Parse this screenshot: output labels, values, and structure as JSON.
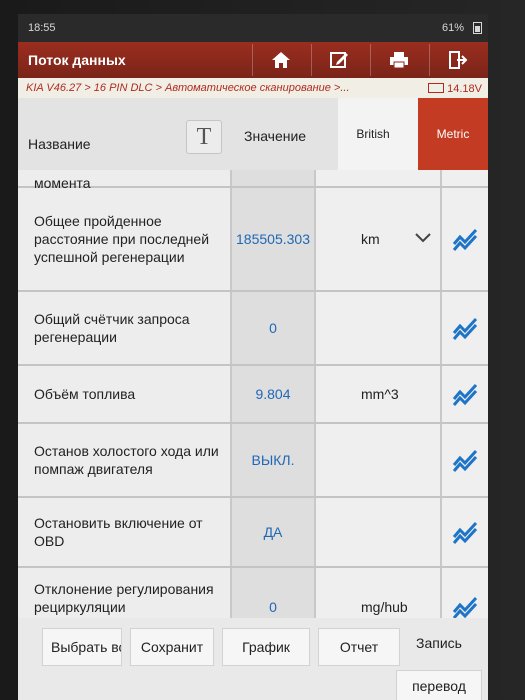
{
  "status": {
    "time": "18:55",
    "battery": "61%"
  },
  "appbar": {
    "title": "Поток данных"
  },
  "breadcrumb": {
    "path": "KIA V46.27 > 16 PIN DLC > Автоматическое сканирование >...",
    "voltage": "14.18V"
  },
  "header": {
    "name_label": "Название",
    "value_label": "Значение",
    "unit_british": "British",
    "unit_metric": "Metric",
    "t_icon": "T"
  },
  "rows": [
    {
      "name": "момента",
      "value": "",
      "unit": ""
    },
    {
      "name": "Общее пройденное расстояние при последней успешной регенерации",
      "value": "185505.303",
      "unit": "km"
    },
    {
      "name": "Общий счётчик запроса регенерации",
      "value": "0",
      "unit": ""
    },
    {
      "name": "Объём топлива",
      "value": "9.804",
      "unit": "mm^3"
    },
    {
      "name": "Останов холостого хода или помпаж двигателя",
      "value": "ВЫКЛ.",
      "unit": ""
    },
    {
      "name": "Остановить включение от OBD",
      "value": "ДА",
      "unit": ""
    },
    {
      "name": "Отклонение регулирования рециркуляции",
      "value": "0",
      "unit": "mg/hub"
    }
  ],
  "bottom": {
    "select": "Выбрать все",
    "save": "Сохранит",
    "graph": "График",
    "report": "Отчет",
    "record": "Запись",
    "translate": "перевод"
  },
  "colors": {
    "appbar": "#8e2a1c",
    "accent": "#c23b22",
    "value": "#2068b5"
  },
  "icons": {
    "home": "home-icon",
    "edit": "edit-icon",
    "print": "print-icon",
    "exit": "exit-icon",
    "chart": "chart-icon"
  }
}
